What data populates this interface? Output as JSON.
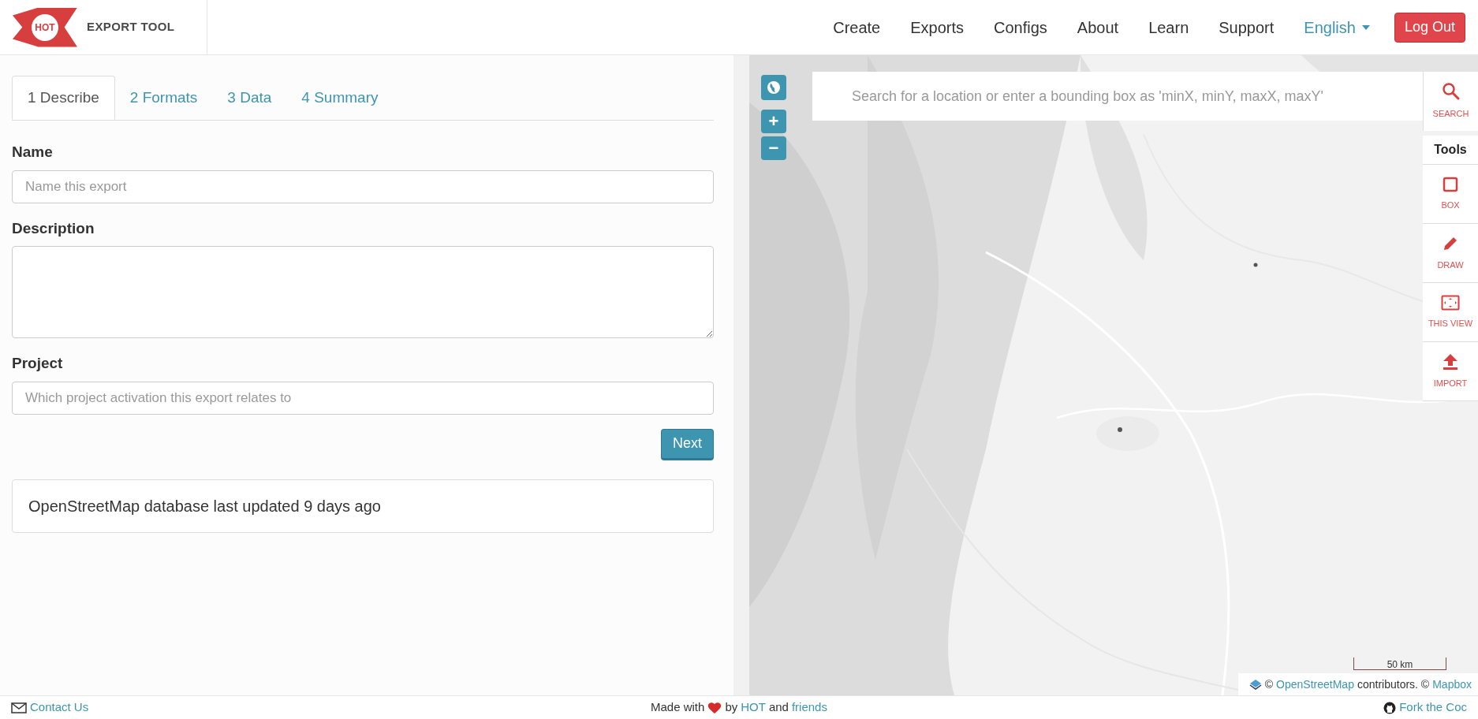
{
  "header": {
    "logo_text": "HOT",
    "brand": "EXPORT TOOL",
    "nav": [
      "Create",
      "Exports",
      "Configs",
      "About",
      "Learn",
      "Support"
    ],
    "language": "English",
    "logout": "Log Out"
  },
  "tabs": [
    {
      "label": "1 Describe",
      "selected": true
    },
    {
      "label": "2 Formats",
      "selected": false
    },
    {
      "label": "3 Data",
      "selected": false
    },
    {
      "label": "4 Summary",
      "selected": false
    }
  ],
  "form": {
    "fields": [
      {
        "label": "Name",
        "kind": "input",
        "placeholder": "Name this export"
      },
      {
        "label": "Description",
        "kind": "textarea"
      },
      {
        "label": "Project",
        "kind": "input",
        "placeholder": "Which project activation this export relates to"
      }
    ],
    "next": "Next"
  },
  "status": "OpenStreetMap database last updated 9 days ago",
  "map": {
    "zoom_in": "+",
    "zoom_out": "−",
    "search_placeholder": "Search for a location or enter a bounding box as 'minX, minY, maxX, maxY'",
    "search_label": "SEARCH",
    "tools_heading": "Tools",
    "tools": [
      {
        "kind": "box",
        "label": "BOX"
      },
      {
        "kind": "draw",
        "label": "DRAW"
      },
      {
        "kind": "view",
        "label": "THIS VIEW"
      },
      {
        "kind": "import",
        "label": "IMPORT"
      }
    ],
    "scale": "50 km",
    "attribution": {
      "copy1": "©",
      "osm": "OpenStreetMap",
      "middle": "contributors. ©",
      "mapbox": "Mapbox"
    }
  },
  "footer": {
    "contact": "Contact Us",
    "made_with": "Made with",
    "by": "by",
    "hot": "HOT",
    "and": "and",
    "friends": "friends",
    "fork": "Fork the Coc"
  }
}
